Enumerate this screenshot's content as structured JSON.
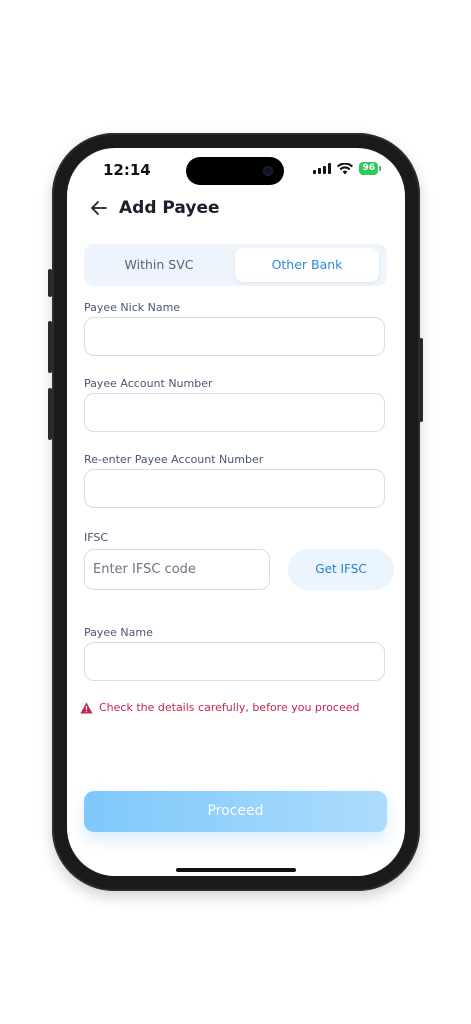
{
  "status": {
    "time": "12:14",
    "battery": "96"
  },
  "header": {
    "title": "Add Payee",
    "back_icon": "arrow-left-icon"
  },
  "tabs": [
    {
      "label": "Within SVC",
      "selected": false
    },
    {
      "label": "Other Bank",
      "selected": true
    }
  ],
  "form": {
    "nick_name_label": "Payee Nick Name",
    "account_label": "Payee Account Number",
    "reenter_label": "Re-enter Payee Account Number",
    "ifsc_label": "IFSC",
    "ifsc_placeholder": "Enter IFSC code",
    "get_ifsc_label": "Get IFSC",
    "payee_name_label": "Payee Name"
  },
  "warning": {
    "text": "Check the details carefully, before you proceed",
    "icon": "warning-triangle-icon",
    "color": "#c4264a"
  },
  "proceed_label": "Proceed",
  "colors": {
    "accent": "#2c8be0",
    "proceed_start": "#7ec8fb",
    "proceed_end": "#acdcfc"
  }
}
